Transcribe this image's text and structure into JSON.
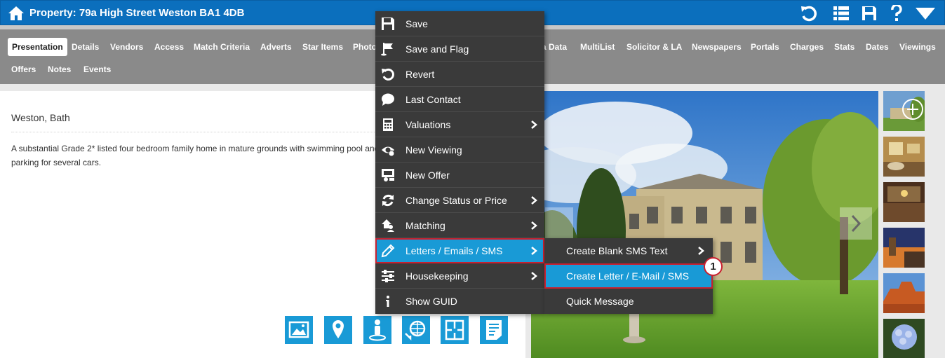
{
  "header": {
    "title": "Property: 79a High Street Weston BA1 4DB",
    "icons": [
      "home-icon",
      "undo-icon",
      "list-icon",
      "save-icon",
      "help-icon",
      "dropdown-icon"
    ]
  },
  "tabs": {
    "row1": [
      "Presentation",
      "Details",
      "Vendors",
      "Access",
      "Match Criteria",
      "Adverts",
      "Star Items",
      "Photo",
      "a Data",
      "MultiList",
      "Solicitor & LA",
      "Newspapers",
      "Portals",
      "Charges",
      "Stats",
      "Dates",
      "Viewings"
    ],
    "row2": [
      "Offers",
      "Notes",
      "Events"
    ],
    "active": "Presentation"
  },
  "property": {
    "location": "Weston, Bath",
    "description": "A substantial Grade 2* listed four bedroom family home in mature grounds with swimming pool and parking for several cars."
  },
  "bottom_icons": [
    "gallery-icon",
    "map-pin-icon",
    "street-view-icon",
    "virtual-tour-icon",
    "floorplan-icon",
    "brochure-icon"
  ],
  "context_menu": {
    "items": [
      {
        "label": "Save",
        "icon": "floppy-disk-icon",
        "submenu": false
      },
      {
        "label": "Save and Flag",
        "icon": "flag-icon",
        "submenu": false
      },
      {
        "label": "Revert",
        "icon": "revert-icon",
        "submenu": false
      },
      {
        "label": "Last Contact",
        "icon": "speech-bubble-icon",
        "submenu": false
      },
      {
        "label": "Valuations",
        "icon": "calculator-icon",
        "submenu": true
      },
      {
        "label": "New Viewing",
        "icon": "eye-icon",
        "submenu": false
      },
      {
        "label": "New Offer",
        "icon": "offer-icon",
        "submenu": false
      },
      {
        "label": "Change Status or Price",
        "icon": "refresh-icon",
        "submenu": true
      },
      {
        "label": "Matching",
        "icon": "people-house-icon",
        "submenu": true
      },
      {
        "label": "Letters / Emails / SMS",
        "icon": "pencil-icon",
        "submenu": true,
        "highlighted": true
      },
      {
        "label": "Housekeeping",
        "icon": "sliders-icon",
        "submenu": true
      },
      {
        "label": "Show GUID",
        "icon": "info-icon",
        "submenu": false
      }
    ]
  },
  "submenu": {
    "items": [
      {
        "label": "Create Blank SMS Text",
        "submenu": true
      },
      {
        "label": "Create Letter / E-Mail / SMS",
        "submenu": false,
        "highlighted": true
      },
      {
        "label": "Quick Message",
        "submenu": false
      }
    ]
  },
  "callout": {
    "number": "1"
  },
  "colors": {
    "header_blue": "#0b6fbd",
    "accent_blue": "#199ad6",
    "menu_bg": "#3a3a3a",
    "highlight_border": "#c8202f",
    "tab_bar": "#8a8a8a"
  }
}
